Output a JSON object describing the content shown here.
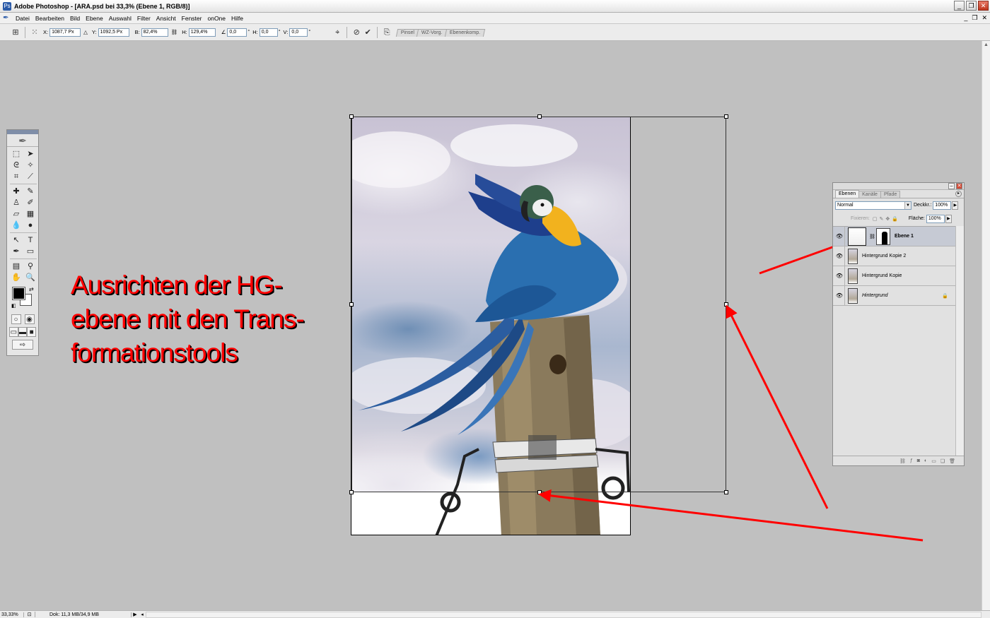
{
  "window": {
    "title": "Adobe Photoshop - [ARA.psd bei 33,3% (Ebene 1, RGB/8)]",
    "min_glyph": "_",
    "max_glyph": "❐",
    "close_glyph": "✕"
  },
  "menu": {
    "items": [
      "Datei",
      "Bearbeiten",
      "Bild",
      "Ebene",
      "Auswahl",
      "Filter",
      "Ansicht",
      "Fenster",
      "onOne",
      "Hilfe"
    ]
  },
  "options": {
    "x_label": "X:",
    "x_value": "1087,7 Px",
    "delta_label": "△",
    "y_label": "Y:",
    "y_value": "1092,5 Px",
    "w_label": "B:",
    "w_value": "82,4%",
    "h_label": "H:",
    "h_value": "129,4%",
    "angle_label": "∠",
    "angle_value": "0,0",
    "angle_unit": "°",
    "hskew_label": "H:",
    "hskew_value": "0,0",
    "hskew_unit": "°",
    "vskew_label": "V:",
    "vskew_value": "0,0",
    "vskew_unit": "°",
    "cancel_glyph": "⊘",
    "commit_glyph": "✔",
    "palette_well_tabs": [
      "Pinsel",
      "WZ-Vorg.",
      "Ebenenkomp."
    ]
  },
  "annotation": {
    "line1": "Ausrichten der HG-",
    "line2": "ebene mit den Trans-",
    "line3": "formationstools"
  },
  "colors": {
    "annotation_red": "#ff0000",
    "workspace_gray": "#c0c0c0",
    "foreground": "#000000",
    "background": "#ffffff"
  },
  "layers_panel": {
    "tabs": [
      "Ebenen",
      "Kanäle",
      "Pfade"
    ],
    "blend_mode": "Normal",
    "opacity_label": "Deckkr.:",
    "opacity_value": "100%",
    "lock_label": "Fixieren:",
    "fill_label": "Fläche:",
    "fill_value": "100%",
    "layers": [
      {
        "name": "Ebene 1",
        "active": true,
        "has_mask": true
      },
      {
        "name": "Hintergrund Kopie 2",
        "active": false,
        "has_mask": false
      },
      {
        "name": "Hintergrund Kopie",
        "active": false,
        "has_mask": false
      },
      {
        "name": "Hintergrund",
        "active": false,
        "has_mask": false,
        "locked": true
      }
    ],
    "footer_icons": [
      "link-icon",
      "style-icon",
      "mask-icon",
      "adjustment-icon",
      "group-icon",
      "new-layer-icon",
      "trash-icon"
    ]
  },
  "status": {
    "zoom": "33,33%",
    "doc": "Dok: 11,3 MB/34,9 MB"
  },
  "toolbox": {
    "tools": [
      "marquee-icon",
      "move-icon",
      "lasso-icon",
      "magic-wand-icon",
      "crop-icon",
      "slice-icon",
      "healing-icon",
      "brush-icon",
      "stamp-icon",
      "history-brush-icon",
      "eraser-icon",
      "gradient-icon",
      "blur-icon",
      "dodge-icon",
      "path-select-icon",
      "type-icon",
      "pen-icon",
      "shape-icon",
      "notes-icon",
      "eyedropper-icon",
      "hand-icon",
      "zoom-icon"
    ]
  }
}
